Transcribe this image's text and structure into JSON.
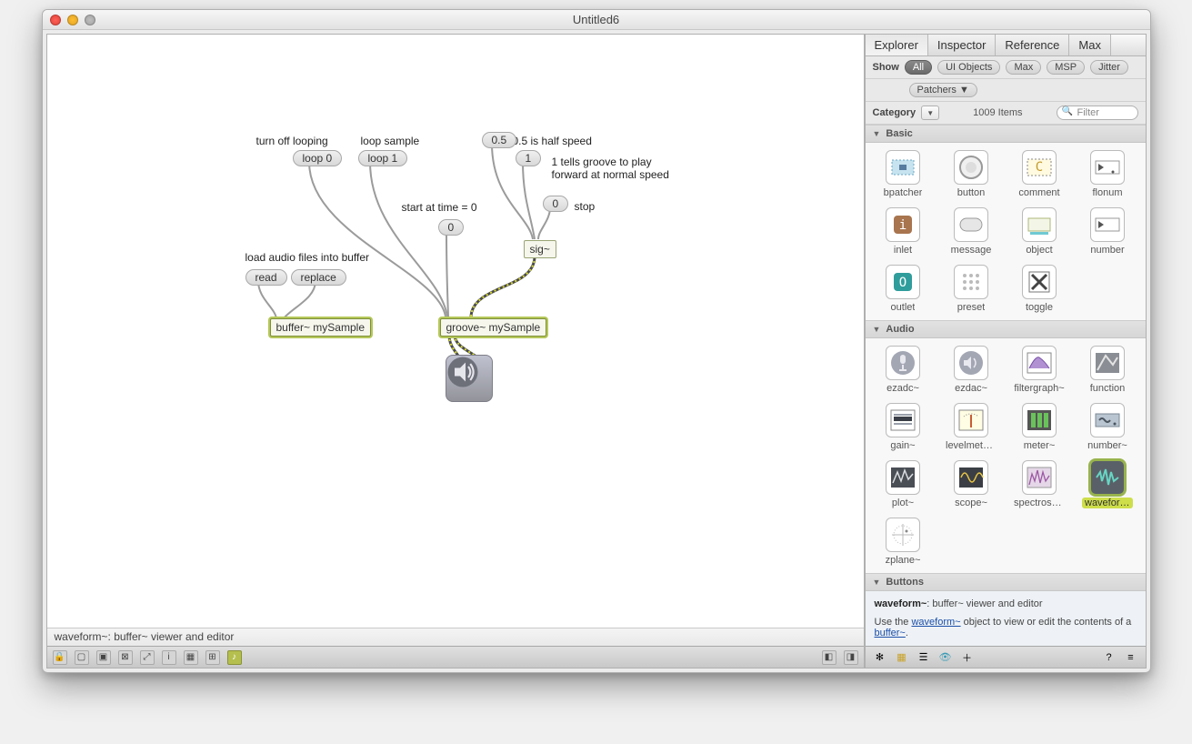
{
  "window": {
    "title": "Untitled6"
  },
  "canvas": {
    "comments": {
      "load_comment": "load audio files into buffer",
      "turn_off": "turn off looping",
      "loop_sample": "loop sample",
      "half_speed": "0.5 is half speed",
      "tells": "1 tells groove to play\nforward at normal speed",
      "start0": "start at time = 0",
      "stop": "stop"
    },
    "messages": {
      "read": "read",
      "replace": "replace",
      "loop0": "loop 0",
      "loop1": "loop 1",
      "half": "0.5",
      "one": "1",
      "zero": "0",
      "zero2": "0"
    },
    "objects": {
      "buffer": "buffer~ mySample",
      "groove": "groove~ mySample",
      "sig": "sig~"
    }
  },
  "status": {
    "text": "waveform~: buffer~ viewer and editor"
  },
  "sidebar": {
    "tabs": [
      "Explorer",
      "Inspector",
      "Reference",
      "Max"
    ],
    "active_tab": 0,
    "show_label": "Show",
    "filters": [
      "All",
      "UI Objects",
      "Max",
      "MSP",
      "Jitter"
    ],
    "patchers_label": "Patchers ▼",
    "category_label": "Category",
    "count_label": "1009 Items",
    "search_placeholder": "Filter",
    "sections": {
      "basic": {
        "title": "Basic",
        "items": [
          "bpatcher",
          "button",
          "comment",
          "flonum",
          "inlet",
          "message",
          "object",
          "number",
          "outlet",
          "preset",
          "toggle"
        ]
      },
      "audio": {
        "title": "Audio",
        "items": [
          "ezadc~",
          "ezdac~",
          "filtergraph~",
          "function",
          "gain~",
          "levelmeter~",
          "meter~",
          "number~",
          "plot~",
          "scope~",
          "spectroscope~",
          "waveform~",
          "zplane~"
        ]
      },
      "buttons": {
        "title": "Buttons"
      }
    },
    "help": {
      "title": "waveform~",
      "subtitle": ": buffer~ viewer and editor",
      "body_prefix": "Use the ",
      "link1": "waveform~",
      "body_mid": " object to view or edit the contents of a ",
      "link2": "buffer~",
      "body_suffix": "."
    }
  }
}
